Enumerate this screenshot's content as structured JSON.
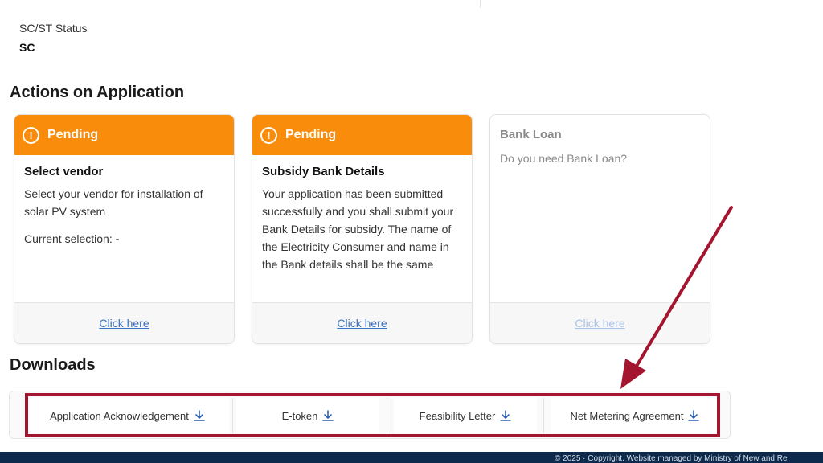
{
  "applicant": {
    "caste_label": "SC/ST Status",
    "caste_value": "SC"
  },
  "actions": {
    "title": "Actions on Application",
    "cards": [
      {
        "status": "Pending",
        "title": "Select vendor",
        "text": "Select your vendor for installation of solar PV system",
        "selection_label": "Current selection:",
        "selection_value": "-",
        "link": "Click here"
      },
      {
        "status": "Pending",
        "title": "Subsidy Bank Details",
        "text": "Your application has been submitted successfully and you shall submit your Bank Details for subsidy. The name of the Electricity Consumer and name in the Bank details shall be the same",
        "link": "Click here"
      },
      {
        "title": "Bank Loan",
        "text": "Do you need Bank Loan?",
        "link": "Click here"
      }
    ]
  },
  "downloads": {
    "title": "Downloads",
    "items": [
      {
        "label": "Application Acknowledgement",
        "icon": "download-icon"
      },
      {
        "label": "E-token",
        "icon": "download-icon"
      },
      {
        "label": "Feasibility Letter",
        "icon": "download-icon"
      },
      {
        "label": "Net Metering Agreement",
        "icon": "download-icon"
      }
    ]
  },
  "footer": {
    "text": "© 2025 · Copyright. Website managed by Ministry of New and Re"
  },
  "colors": {
    "pending": "#f98c0b",
    "link": "#3a72c4",
    "annotation": "#a4162f",
    "footer_bg": "#0d2a4d"
  }
}
